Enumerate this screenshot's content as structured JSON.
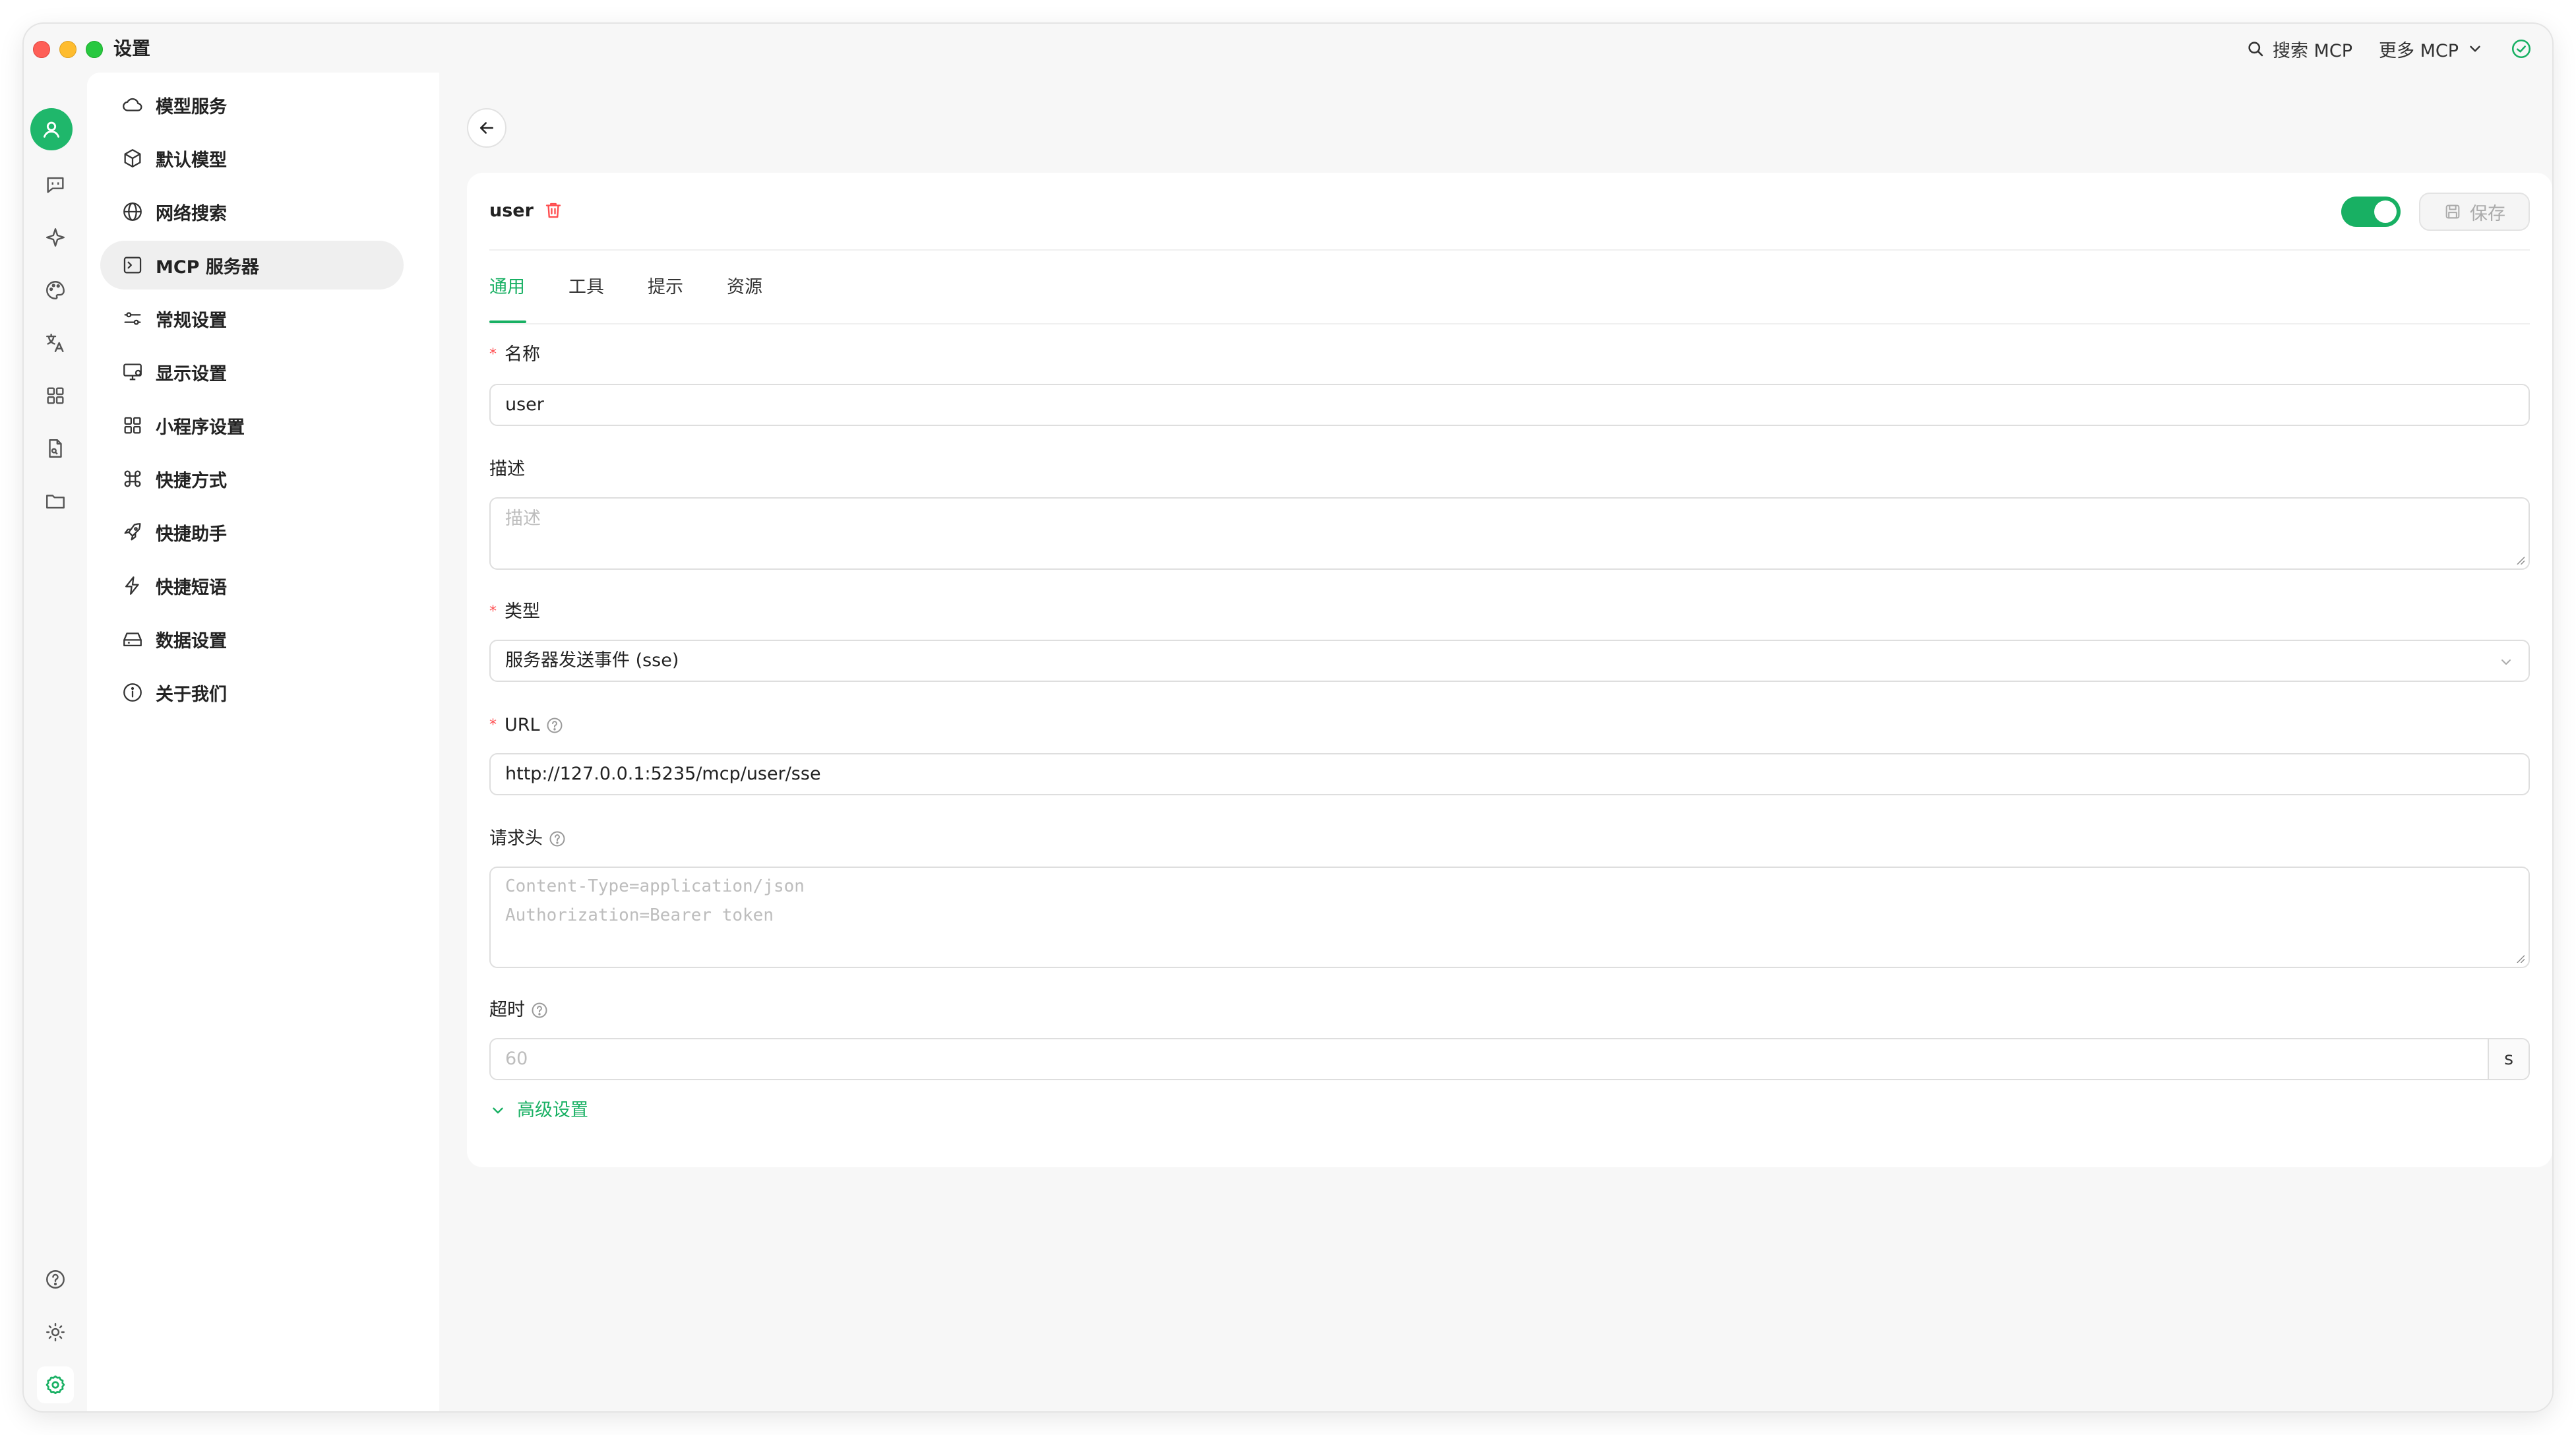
{
  "window": {
    "title": "设置"
  },
  "titlebar": {
    "search_label": "搜索 MCP",
    "more_label": "更多 MCP",
    "search_icon": "search-icon",
    "more_icon": "chevron-down-icon",
    "status_icon": "check-circle-icon"
  },
  "colors": {
    "accent": "#18b063",
    "danger": "#ff4d4f",
    "avatar": "#1fb76b"
  },
  "rail": {
    "top_icons": [
      "user-avatar-icon",
      "chat-icon",
      "sparkle-icon",
      "palette-icon",
      "translate-icon",
      "apps-grid-icon",
      "document-icon",
      "folder-icon"
    ],
    "bottom_icons": [
      "help-icon",
      "theme-icon",
      "settings-icon"
    ]
  },
  "nav": {
    "items": [
      {
        "label": "模型服务",
        "icon": "cloud-icon"
      },
      {
        "label": "默认模型",
        "icon": "cube-icon"
      },
      {
        "label": "网络搜索",
        "icon": "globe-icon"
      },
      {
        "label": "MCP 服务器",
        "icon": "terminal-icon",
        "active": true
      },
      {
        "label": "常规设置",
        "icon": "sliders-icon"
      },
      {
        "label": "显示设置",
        "icon": "monitor-icon"
      },
      {
        "label": "小程序设置",
        "icon": "apps-grid-icon"
      },
      {
        "label": "快捷方式",
        "icon": "command-icon"
      },
      {
        "label": "快捷助手",
        "icon": "rocket-icon"
      },
      {
        "label": "快捷短语",
        "icon": "lightning-icon"
      },
      {
        "label": "数据设置",
        "icon": "hard-drive-icon"
      },
      {
        "label": "关于我们",
        "icon": "info-icon"
      }
    ]
  },
  "server": {
    "name": "user",
    "enabled": true,
    "save_label": "保存"
  },
  "tabs": [
    "通用",
    "工具",
    "提示",
    "资源"
  ],
  "form": {
    "name": {
      "label": "名称",
      "value": "user"
    },
    "description": {
      "label": "描述",
      "placeholder": "描述"
    },
    "type": {
      "label": "类型",
      "value": "服务器发送事件 (sse)"
    },
    "url": {
      "label": "URL",
      "value": "http://127.0.0.1:5235/mcp/user/sse"
    },
    "headers": {
      "label": "请求头",
      "placeholder_line1": "Content-Type=application/json",
      "placeholder_line2": "Authorization=Bearer token"
    },
    "timeout": {
      "label": "超时",
      "placeholder": "60",
      "unit": "s"
    },
    "advanced_label": "高级设置"
  }
}
